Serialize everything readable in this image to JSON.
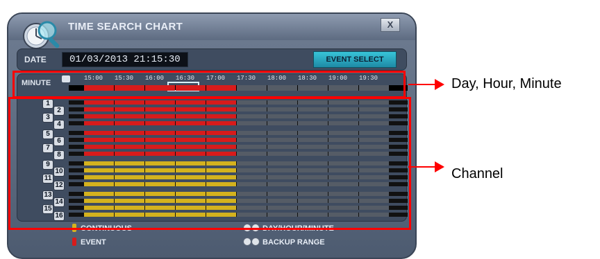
{
  "window": {
    "title": "TIME SEARCH CHART",
    "close_label": "X"
  },
  "date": {
    "label": "DATE",
    "value": "01/03/2013 21:15:30",
    "event_select": "EVENT SELECT"
  },
  "minute": {
    "label": "MINUTE",
    "times": [
      "15:00",
      "15:30",
      "16:00",
      "16:30",
      "17:00",
      "17:30",
      "18:00",
      "18:30",
      "19:00",
      "19:30"
    ],
    "record_color": "#d81b1b",
    "empty_color": "#555c66"
  },
  "channels": {
    "groups": [
      {
        "badges": [
          "1",
          "2",
          "3",
          "4"
        ]
      },
      {
        "badges": [
          "5",
          "6",
          "7",
          "8"
        ]
      },
      {
        "badges": [
          "9",
          "10",
          "11",
          "12"
        ]
      },
      {
        "badges": [
          "13",
          "14",
          "15",
          "16"
        ]
      }
    ],
    "continuous_color": "#d4b21e",
    "event_color": "#d81b1b",
    "empty_color": "#555c66"
  },
  "legend": {
    "continuous": "CONTINUOUS",
    "event": "EVENT",
    "day_hour_minute": "DAY/HOUR/MINUTE",
    "backup_range": "BACKUP RANGE"
  },
  "annotations": {
    "top_label": "Day, Hour, Minute",
    "bottom_label": "Channel"
  }
}
